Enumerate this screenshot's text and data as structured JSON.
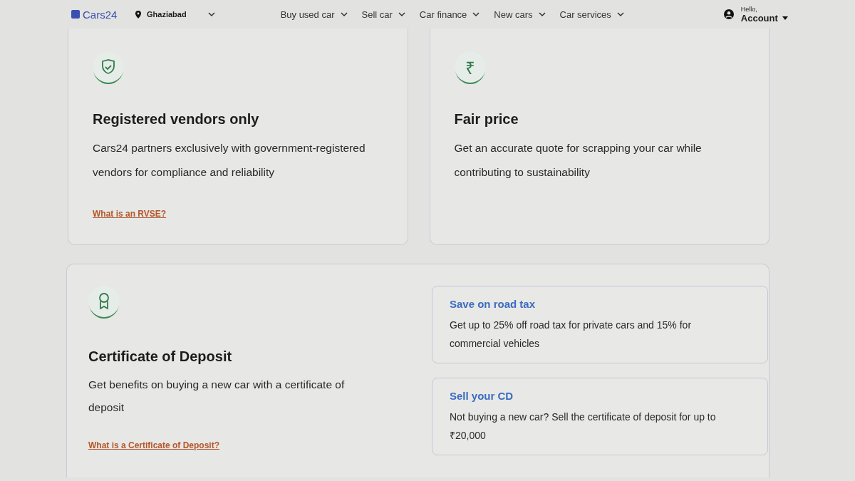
{
  "header": {
    "logo": "Cars24",
    "location": "Ghaziabad",
    "nav": [
      {
        "label": "Buy used car"
      },
      {
        "label": "Sell car"
      },
      {
        "label": "Car finance"
      },
      {
        "label": "New cars"
      },
      {
        "label": "Car services"
      }
    ],
    "greeting": "Hello,",
    "account": "Account"
  },
  "features": [
    {
      "title": "Registered vendors only",
      "text": "Cars24 partners exclusively with government-registered vendors for compliance and reliability",
      "link": "What is an RVSE?"
    },
    {
      "glyph": "₹",
      "title": "Fair price",
      "text": "Get an accurate quote for scrapping your car while contributing to sustainability"
    }
  ],
  "deposit": {
    "title": "Certificate of Deposit",
    "text": "Get benefits on buying a new car with a certificate of deposit",
    "link": "What is a Certificate of Deposit?",
    "benefits": [
      {
        "title": "Save on road tax",
        "text": "Get up to 25% off road tax for private cars and 15% for commercial vehicles"
      },
      {
        "title": "Sell your CD",
        "text": "Not buying a new car? Sell the certificate of deposit for up to ₹20,000"
      }
    ]
  }
}
